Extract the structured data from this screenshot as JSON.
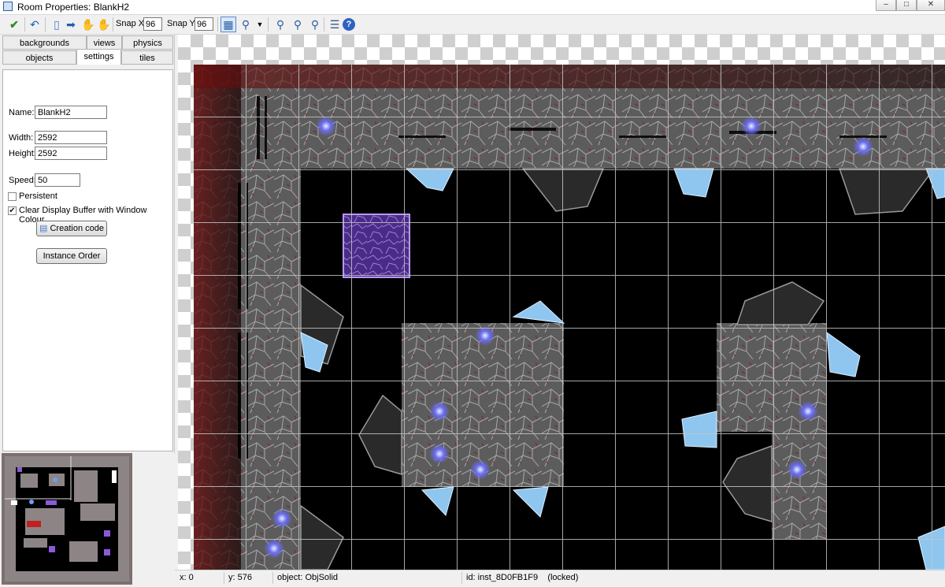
{
  "window": {
    "title": "Room Properties: BlankH2",
    "controls": [
      "minimize",
      "maximize",
      "close"
    ]
  },
  "toolbar": {
    "snap_x_label": "Snap X:",
    "snap_x_value": "96",
    "snap_y_label": "Snap Y:",
    "snap_y_value": "96",
    "icons": [
      "ok-check-icon",
      "undo-icon",
      "clear-icon",
      "shift-arrow-icon",
      "hand-icon",
      "hand-lock-icon",
      "grid-icon",
      "zoom-dropdown-icon",
      "zoom-icon",
      "zoom-in-icon",
      "zoom-out-icon",
      "list-icon",
      "help-icon"
    ]
  },
  "tabs": {
    "row1": [
      "backgrounds",
      "views",
      "physics"
    ],
    "row2": [
      "objects",
      "settings",
      "tiles"
    ],
    "active": "settings"
  },
  "settings": {
    "name_label": "Name:",
    "name_value": "BlankH2",
    "width_label": "Width:",
    "width_value": "2592",
    "height_label": "Height:",
    "height_value": "2592",
    "speed_label": "Speed:",
    "speed_value": "50",
    "persistent_label": "Persistent",
    "persistent_checked": false,
    "clear_display_label": "Clear Display Buffer with Window Colour",
    "clear_display_checked": true,
    "creation_code_label": "Creation code",
    "instance_order_label": "Instance Order"
  },
  "status": {
    "x": "x: 0",
    "y": "y: 576",
    "object": "object: ObjSolid",
    "id": "id: inst_8D0FB1F9    (locked)"
  },
  "colors": {
    "room_bg": "#000000",
    "grid": "#b8b8b8",
    "rock": "#6e6e6e",
    "crystal": "#8ec6f0",
    "purple_block": "#6b3fb0",
    "red_glow": "#7a1414"
  }
}
